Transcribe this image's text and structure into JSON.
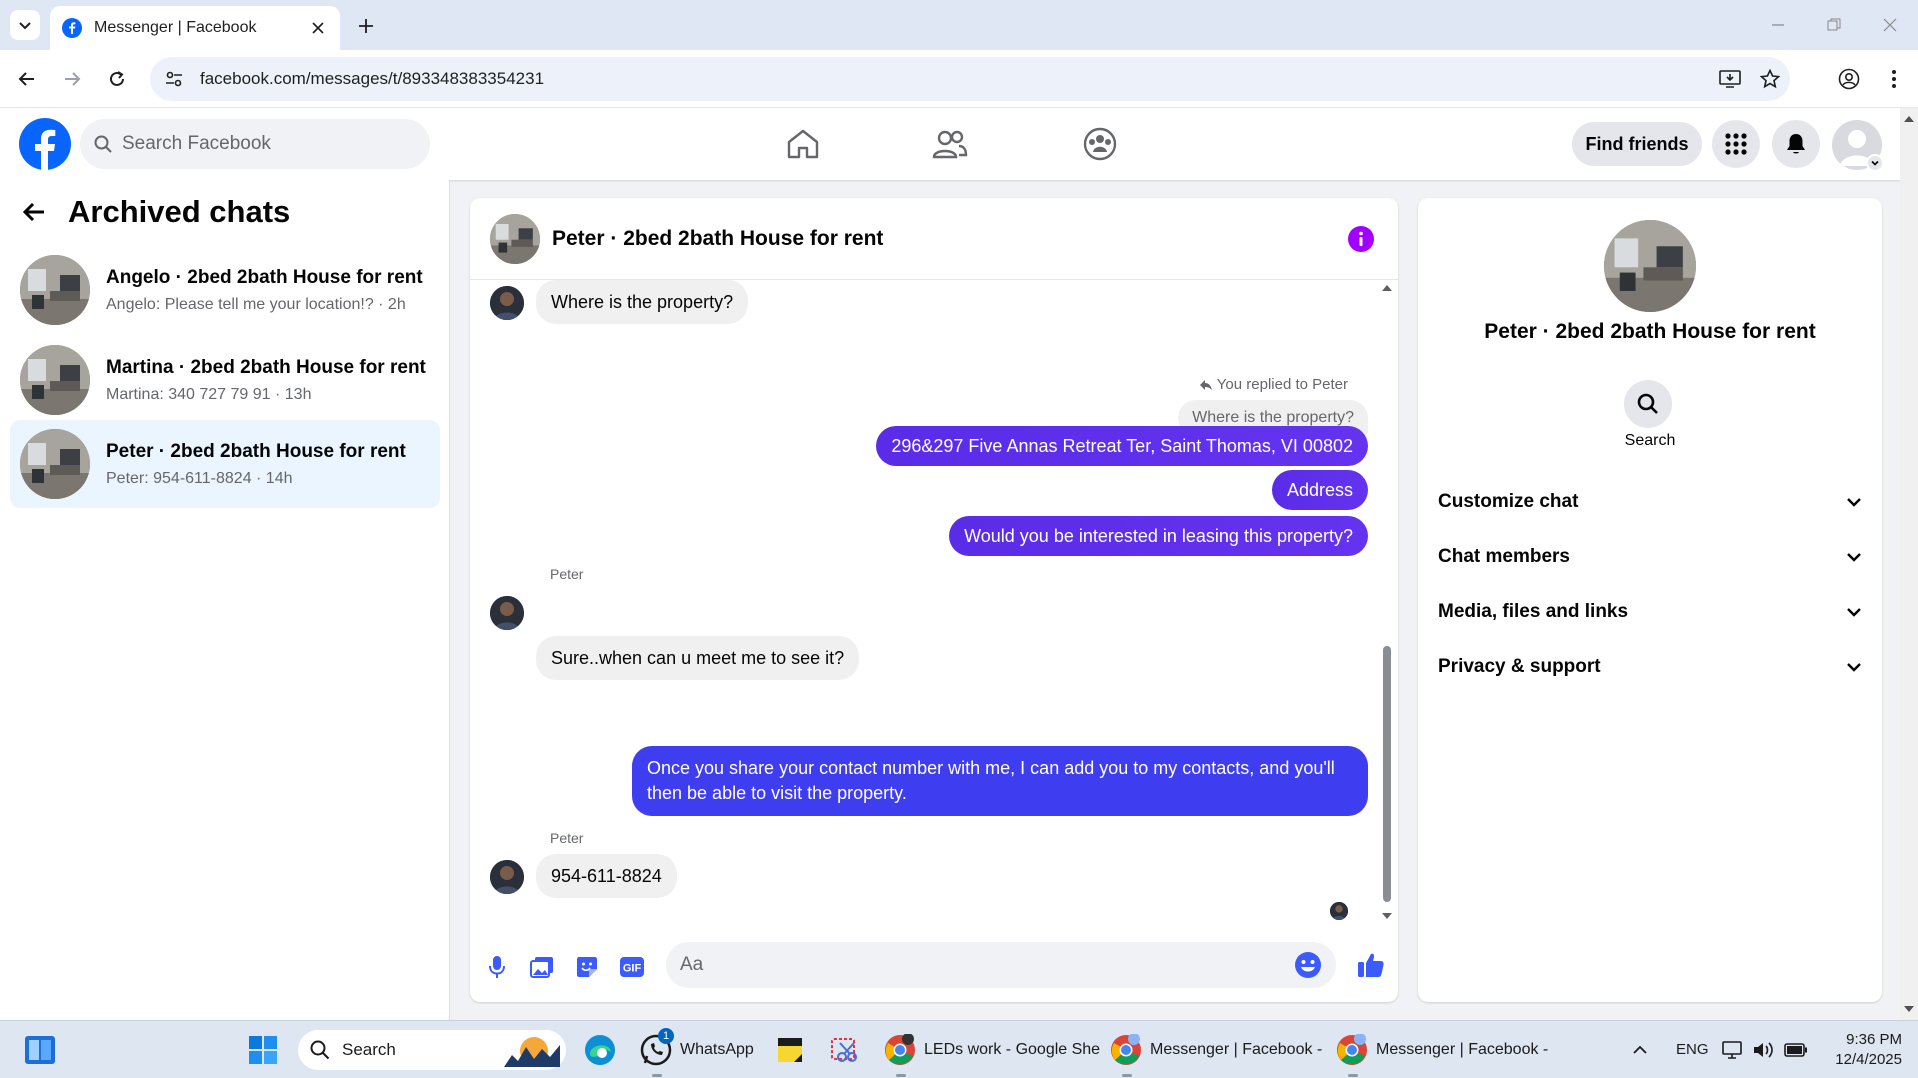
{
  "browser": {
    "tab_title": "Messenger | Facebook",
    "url": "facebook.com/messages/t/893348383354231"
  },
  "fb_header": {
    "search_placeholder": "Search Facebook",
    "find_friends": "Find friends"
  },
  "sidebar": {
    "title": "Archived chats",
    "chats": [
      {
        "name": "Angelo · 2bed 2bath House for rent",
        "preview": "Angelo: Please tell me your location!? · 2h",
        "active": false
      },
      {
        "name": "Martina · 2bed 2bath House for rent",
        "preview": "Martina: 340 727 79 91 · 13h",
        "active": false
      },
      {
        "name": "Peter · 2bed 2bath House for rent",
        "preview": "Peter: 954-611-8824 · 14h",
        "active": true
      }
    ]
  },
  "conversation": {
    "title": "Peter · 2bed 2bath House for rent",
    "messages": {
      "m1": "Where is the property?",
      "replied_label": "You replied to Peter",
      "quoted": "Where is the property?",
      "m2": "296&297 Five Annas Retreat Ter, Saint Thomas, VI 00802",
      "m3": "Address",
      "m4": "Would you be interested in leasing this property?",
      "sender1": "Peter",
      "m5": "Sure..when can u meet me to see it?",
      "m6": "Once you share your contact number with me, I can add you to my contacts, and you'll then be able to visit the property.",
      "sender2": "Peter",
      "m7": "954-611-8824"
    },
    "composer_placeholder": "Aa"
  },
  "info_panel": {
    "name": "Peter · 2bed 2bath House for rent",
    "search_label": "Search",
    "sections": [
      "Customize chat",
      "Chat members",
      "Media, files and links",
      "Privacy & support"
    ]
  },
  "taskbar": {
    "search_label": "Search",
    "whatsapp_label": "WhatsApp",
    "whatsapp_badge": "1",
    "sheets_label": "LEDs work - Google She",
    "messenger1_label": "Messenger | Facebook -",
    "messenger2_label": "Messenger | Facebook -",
    "lang": "ENG",
    "time": "9:36 PM",
    "date": "12/4/2025"
  },
  "colors": {
    "fb_blue": "#0866ff",
    "outgoing_bubble": "#5b2ded",
    "info_accent": "#a100ff"
  }
}
